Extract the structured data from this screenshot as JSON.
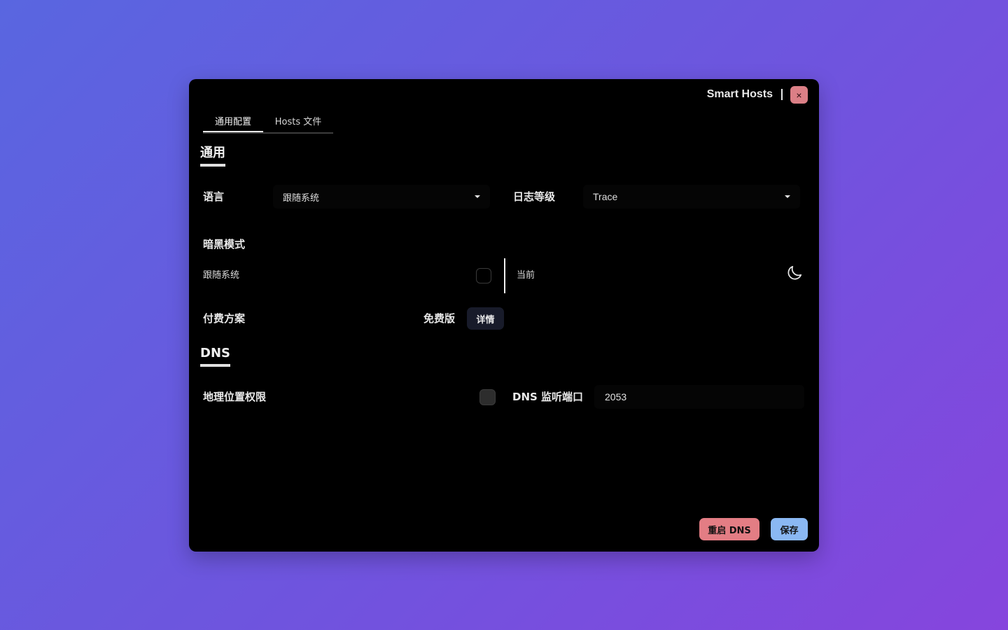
{
  "window": {
    "title": "Smart Hosts",
    "close_icon": "×"
  },
  "tabs": [
    {
      "label": "通用配置",
      "active": true
    },
    {
      "label": "Hosts 文件",
      "active": false
    }
  ],
  "general": {
    "section_title": "通用",
    "language": {
      "label": "语言",
      "value": "跟随系统"
    },
    "log_level": {
      "label": "日志等级",
      "value": "Trace"
    },
    "dark_mode": {
      "label": "暗黑模式",
      "follow_system_label": "跟随系统",
      "follow_system_checked": false,
      "current_label": "当前",
      "current_icon": "moon-icon"
    },
    "plan": {
      "label": "付费方案",
      "value": "免费版",
      "details_label": "详情"
    }
  },
  "dns": {
    "section_title": "DNS",
    "geo_permission": {
      "label": "地理位置权限",
      "checked": false
    },
    "port": {
      "label": "DNS 监听端口",
      "value": "2053"
    }
  },
  "actions": {
    "restart_label": "重启 DNS",
    "save_label": "保存"
  },
  "colors": {
    "background_start": "#5966e0",
    "background_end": "#8645dd",
    "window": "#000000",
    "close_button": "#db7f86",
    "restart_button": "#e37d84",
    "save_button": "#8ab8f3"
  }
}
